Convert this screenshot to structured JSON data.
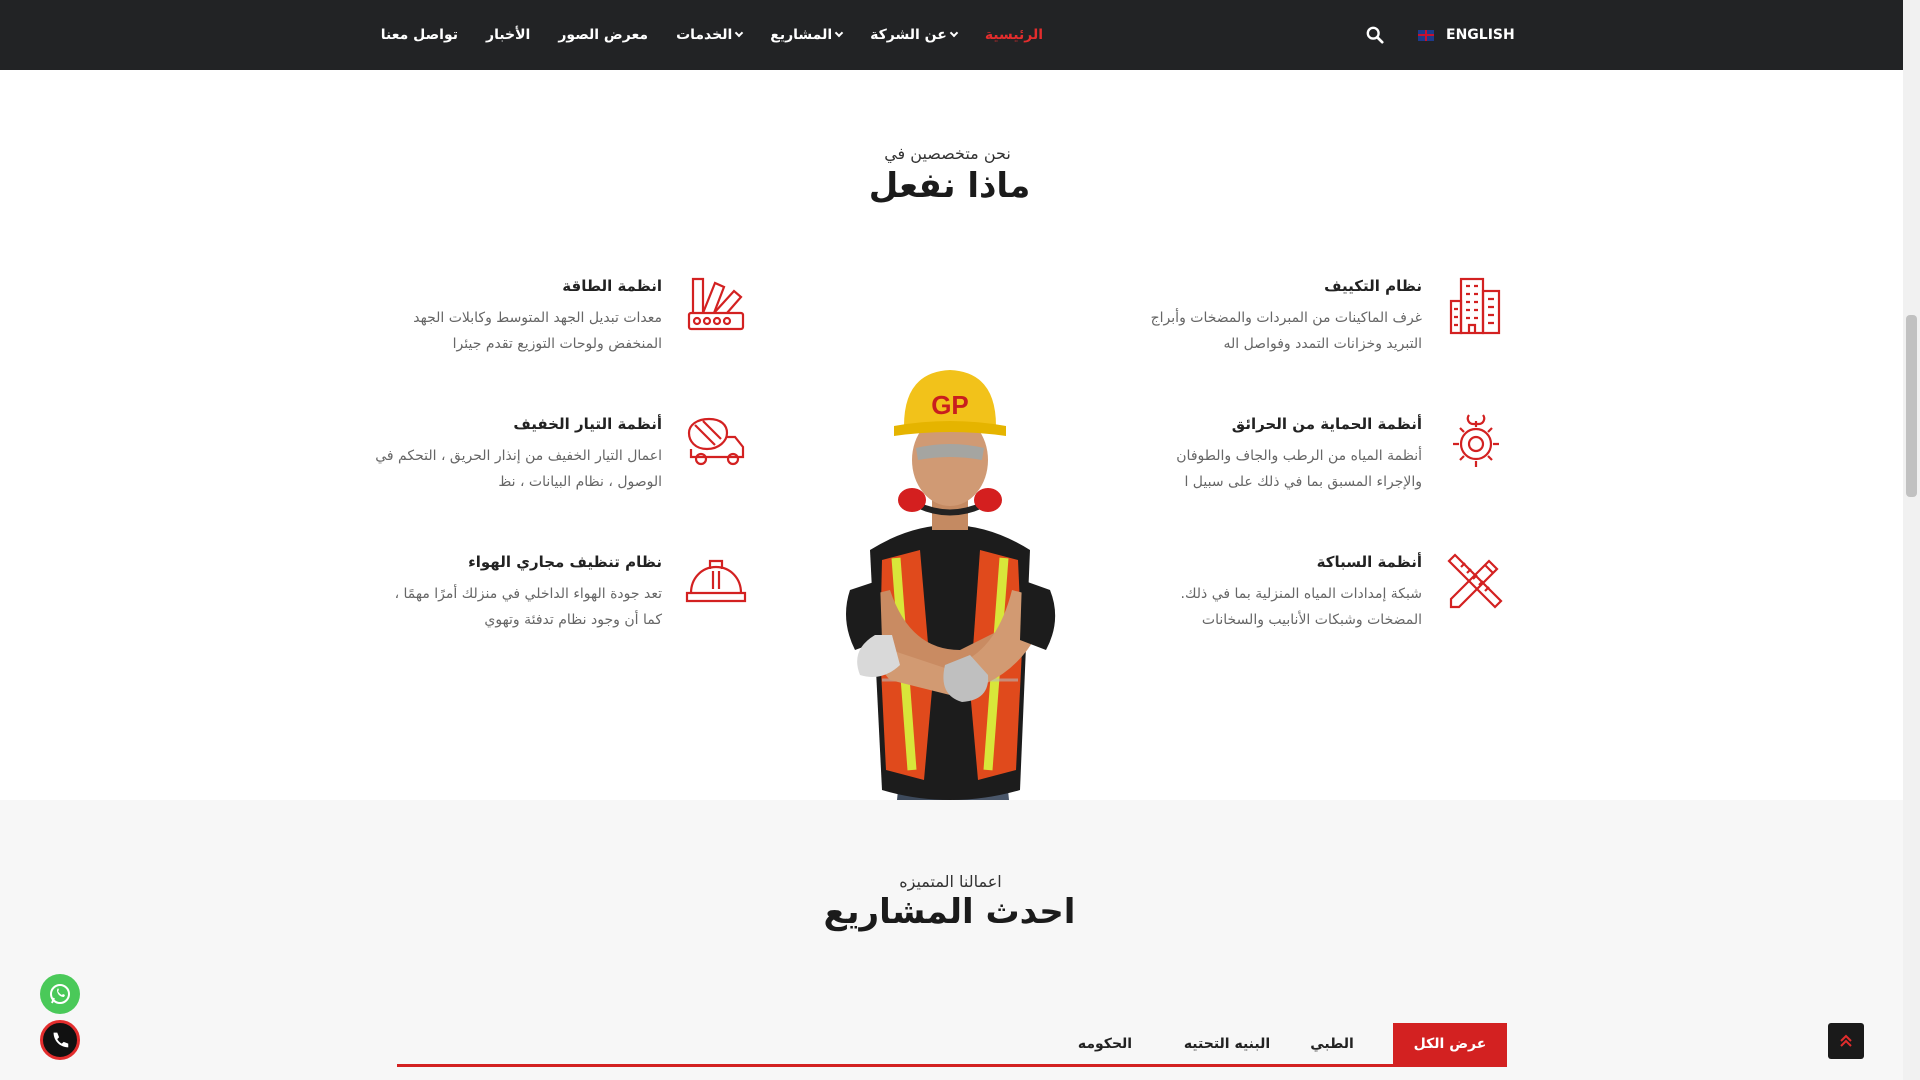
{
  "nav": {
    "items": [
      "الرئيسية",
      "عن الشركة",
      "المشاريع",
      "الخدمات",
      "معرض الصور",
      "الأخبار",
      "تواصل معنا"
    ],
    "language": "ENGLISH"
  },
  "section_services": {
    "eyebrow": "نحن متخصصين في",
    "title": "ماذا نفعل",
    "services": [
      {
        "title": "نظام التكييف",
        "desc": "غرف الماكينات من المبردات والمضخات وأبراج التبريد وخزانات التمدد وفواصل اله",
        "icon": "buildings-icon"
      },
      {
        "title": "أنظمة الحماية من الحرائق",
        "desc": "أنظمة المياه من الرطب والجاف والطوفان والإجراء المسبق بما في ذلك على سبيل ا",
        "icon": "gear-wrench-icon"
      },
      {
        "title": "أنظمة السباكة",
        "desc": "شبكة إمدادات المياه المنزلية بما في ذلك. المضخات وشبكات الأنابيب والسخانات",
        "icon": "pencil-ruler-icon"
      },
      {
        "title": "انظمة الطاقة",
        "desc": "معدات تبديل الجهد المتوسط وكابلات الجهد المنخفض ولوحات التوزيع تقدم جيئرا",
        "icon": "swatches-icon"
      },
      {
        "title": "أنظمة التيار الخفيف",
        "desc": "اعمال التيار الخفيف من إنذار الحريق ، التحكم في الوصول ، نظام البيانات ، نظ",
        "icon": "mixer-truck-icon"
      },
      {
        "title": "نظام تنظيف مجاري الهواء",
        "desc": "تعد جودة الهواء الداخلي في منزلك أمرًا مهمًا ، كما أن وجود نظام تدفئة وتهوي",
        "icon": "hard-hat-icon"
      }
    ],
    "helmet_logo": "GP"
  },
  "section_projects": {
    "eyebrow": "اعمالنا المتميزه",
    "title": "احدث المشاريع",
    "tabs": [
      "عرض الكل",
      "الطبي",
      "البنيه التحتيه",
      "الحكومه"
    ]
  },
  "colors": {
    "accent": "#d32121",
    "dark": "#222325"
  }
}
